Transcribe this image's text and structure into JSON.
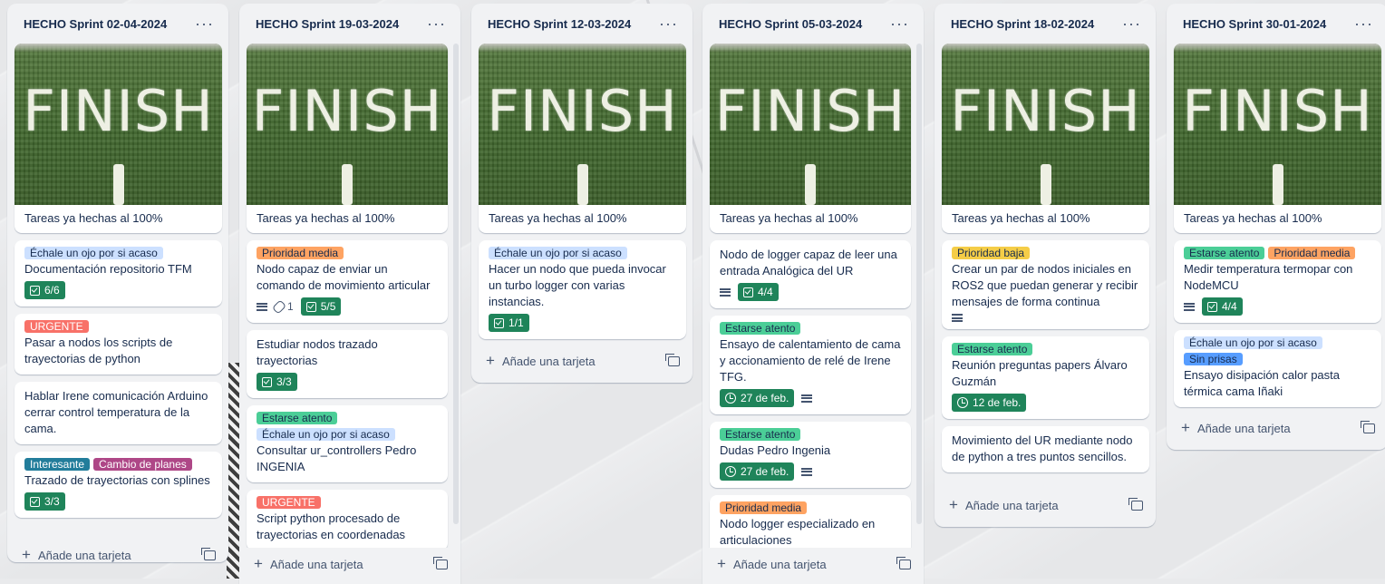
{
  "board": {
    "add_card_label": "Añade una tarjeta",
    "cover_text": "FINISH",
    "lists": [
      {
        "title": "HECHO Sprint 02-04-2024",
        "cards": [
          {
            "cover": true,
            "title": "Tareas ya hechas al 100%"
          },
          {
            "labels": [
              {
                "text": "Échale un ojo por si acaso",
                "color": "#cce0ff"
              }
            ],
            "title": "Documentación repositorio TFM",
            "checklist": "6/6"
          },
          {
            "labels": [
              {
                "text": "URGENTE",
                "color": "#f87168"
              }
            ],
            "title": "Pasar a nodos los scripts de trayectorias de python"
          },
          {
            "title": "Hablar Irene comunicación Arduino cerrar control temperatura de la cama."
          },
          {
            "labels": [
              {
                "text": "Interesante",
                "color": "#227d9b"
              },
              {
                "text": "Cambio de planes",
                "color": "#ae4787"
              }
            ],
            "title": "Trazado de trayectorias con splines",
            "checklist": "3/3"
          }
        ]
      },
      {
        "title": "HECHO Sprint 19-03-2024",
        "cards": [
          {
            "cover": true,
            "title": "Tareas ya hechas al 100%"
          },
          {
            "labels": [
              {
                "text": "Prioridad media",
                "color": "#fea362"
              }
            ],
            "title": "Nodo capaz de enviar un comando de movimiento articular",
            "description": true,
            "attachments": "1",
            "checklist": "5/5"
          },
          {
            "title": "Estudiar nodos trazado trayectorias",
            "checklist": "3/3"
          },
          {
            "labels": [
              {
                "text": "Estarse atento",
                "color": "#4bce97"
              },
              {
                "text": "Échale un ojo por si acaso",
                "color": "#cce0ff"
              }
            ],
            "title": "Consultar ur_controllers Pedro INGENIA"
          },
          {
            "labels": [
              {
                "text": "URGENTE",
                "color": "#f87168"
              }
            ],
            "title": "Script python procesado de trayectorias en coordenadas"
          }
        ]
      },
      {
        "title": "HECHO Sprint 12-03-2024",
        "cards": [
          {
            "cover": true,
            "title": "Tareas ya hechas al 100%"
          },
          {
            "labels": [
              {
                "text": "Échale un ojo por si acaso",
                "color": "#cce0ff"
              }
            ],
            "title": "Hacer un nodo que pueda invocar un turbo logger con varias instancias.",
            "checklist": "1/1"
          }
        ]
      },
      {
        "title": "HECHO Sprint 05-03-2024",
        "cards": [
          {
            "cover": true,
            "title": "Tareas ya hechas al 100%"
          },
          {
            "title": "Nodo de logger capaz de leer una entrada Analógica del UR",
            "description": true,
            "checklist": "4/4"
          },
          {
            "labels": [
              {
                "text": "Estarse atento",
                "color": "#4bce97"
              }
            ],
            "title": "Ensayo de calentamiento de cama y accionamiento de relé de Irene TFG.",
            "date": "27 de feb.",
            "description": true
          },
          {
            "labels": [
              {
                "text": "Estarse atento",
                "color": "#4bce97"
              }
            ],
            "title": "Dudas Pedro Ingenia",
            "date": "27 de feb.",
            "description": true
          },
          {
            "labels": [
              {
                "text": "Prioridad media",
                "color": "#fea362"
              }
            ],
            "title": "Nodo logger especializado en articulaciones"
          }
        ]
      },
      {
        "title": "HECHO Sprint 18-02-2024",
        "cards": [
          {
            "cover": true,
            "title": "Tareas ya hechas al 100%"
          },
          {
            "labels": [
              {
                "text": "Prioridad baja",
                "color": "#f5cd47"
              }
            ],
            "title": "Crear un par de nodos iniciales en ROS2 que puedan generar y recibir mensajes de forma continua",
            "description": true
          },
          {
            "labels": [
              {
                "text": "Estarse atento",
                "color": "#4bce97"
              }
            ],
            "title": "Reunión preguntas papers Álvaro Guzmán",
            "date": "12 de feb."
          },
          {
            "title": "Movimiento del UR mediante nodo de python a tres puntos sencillos."
          }
        ]
      },
      {
        "title": "HECHO Sprint 30-01-2024",
        "cards": [
          {
            "cover": true,
            "title": "Tareas ya hechas al 100%"
          },
          {
            "labels": [
              {
                "text": "Estarse atento",
                "color": "#4bce97"
              },
              {
                "text": "Prioridad media",
                "color": "#fea362"
              }
            ],
            "title": "Medir temperatura termopar con NodeMCU",
            "description": true,
            "checklist": "4/4"
          },
          {
            "labels": [
              {
                "text": "Échale un ojo por si acaso",
                "color": "#cce0ff"
              },
              {
                "text": "Sin prisas",
                "color": "#579dff"
              }
            ],
            "title": "Ensayo disipación calor pasta térmica cama Iñaki"
          }
        ]
      }
    ]
  }
}
